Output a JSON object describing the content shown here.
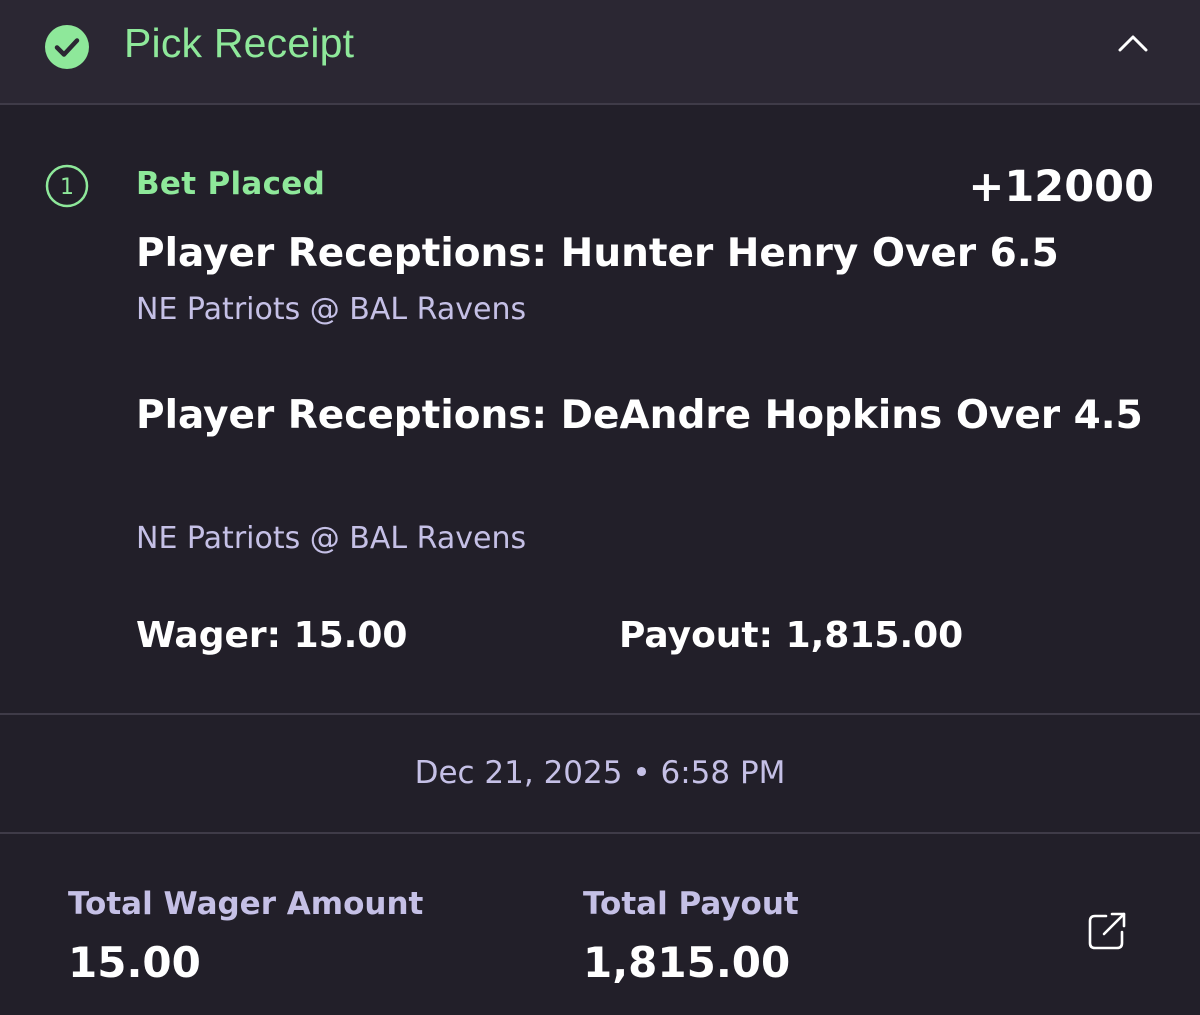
{
  "header": {
    "title": "Pick Receipt",
    "status_icon": "check-circle-icon",
    "collapse_icon": "chevron-up-icon",
    "accent_color": "#8ee89a"
  },
  "bet": {
    "step_number": "1",
    "status": "Bet Placed",
    "odds": "+12000",
    "legs": [
      {
        "title": "Player Receptions: Hunter Henry Over 6.5",
        "matchup": "NE Patriots @ BAL Ravens"
      },
      {
        "title": "Player Receptions: DeAndre Hopkins Over 4.5",
        "matchup": "NE Patriots @ BAL Ravens"
      }
    ],
    "wager_text": "Wager: 15.00",
    "payout_text": "Payout: 1,815.00"
  },
  "timestamp": "Dec 21, 2025 • 6:58 PM",
  "totals": {
    "wager_label": "Total Wager Amount",
    "wager_value": "15.00",
    "payout_label": "Total Payout",
    "payout_value": "1,815.00",
    "share_icon": "share-external-icon"
  }
}
